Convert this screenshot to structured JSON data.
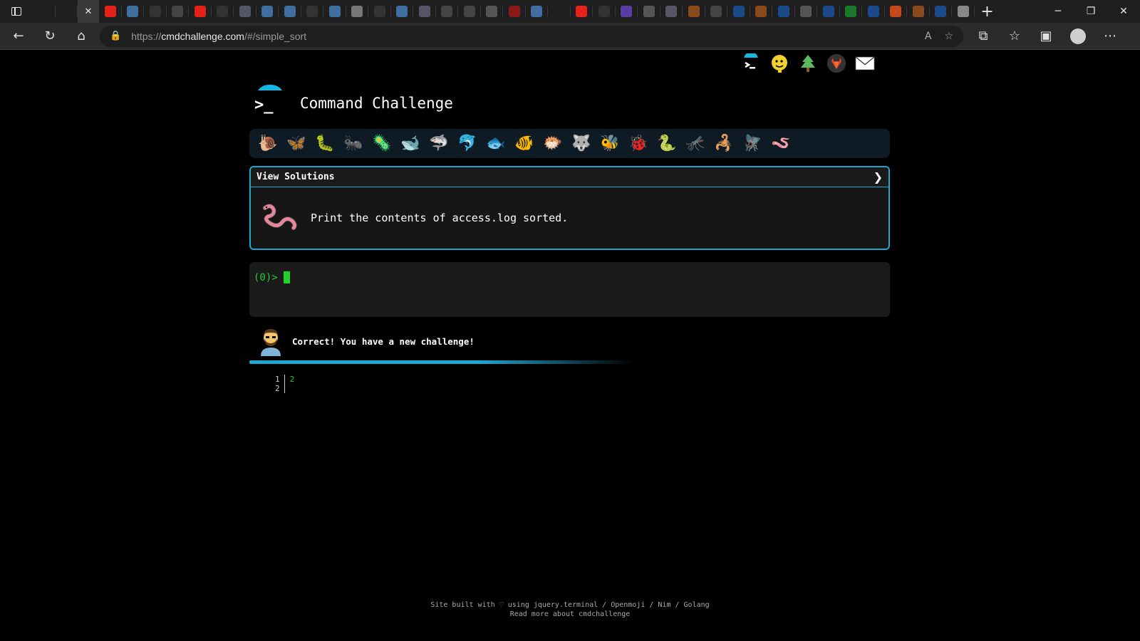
{
  "browser": {
    "url_host": "cmdchallenge.com",
    "url_prefix": "https://",
    "url_path": "/#/simple_sort",
    "tabs": [
      {
        "icon": "blank-icon",
        "color": "#2a2a2a"
      },
      {
        "icon": "blank-icon",
        "color": "#2a2a2a"
      },
      {
        "icon": "close-icon",
        "color": "#3a3a3a",
        "active": true
      },
      {
        "icon": "youtube-icon",
        "color": "#e62117"
      },
      {
        "icon": "python-icon",
        "color": "#3f6fa0"
      },
      {
        "icon": "github-icon",
        "color": "#333"
      },
      {
        "icon": "flickr-icon",
        "color": "#444"
      },
      {
        "icon": "youtube-icon",
        "color": "#e62117"
      },
      {
        "icon": "github-icon",
        "color": "#333"
      },
      {
        "icon": "image-icon",
        "color": "#556"
      },
      {
        "icon": "python-icon",
        "color": "#3f6fa0"
      },
      {
        "icon": "python-icon",
        "color": "#3f6fa0"
      },
      {
        "icon": "github-icon",
        "color": "#333"
      },
      {
        "icon": "python-icon",
        "color": "#3f6fa0"
      },
      {
        "icon": "hexagon-icon",
        "color": "#777"
      },
      {
        "icon": "github-icon",
        "color": "#333"
      },
      {
        "icon": "python-icon",
        "color": "#3f6fa0"
      },
      {
        "icon": "image-icon",
        "color": "#556"
      },
      {
        "icon": "page-icon",
        "color": "#444"
      },
      {
        "icon": "page-icon",
        "color": "#444"
      },
      {
        "icon": "tpg-icon",
        "color": "#555"
      },
      {
        "icon": "youtube-icon",
        "color": "#8a1a1a"
      },
      {
        "icon": "python-icon",
        "color": "#3f6fa0"
      },
      {
        "icon": "blank-icon",
        "color": "#2a2a2a"
      },
      {
        "icon": "youtube-icon",
        "color": "#e62117"
      },
      {
        "icon": "github-icon",
        "color": "#333"
      },
      {
        "icon": "p-icon",
        "color": "#5a3fa0"
      },
      {
        "icon": "table-icon",
        "color": "#555"
      },
      {
        "icon": "image-icon",
        "color": "#556"
      },
      {
        "icon": "stack-icon",
        "color": "#8a4a1a"
      },
      {
        "icon": "page-icon",
        "color": "#444"
      },
      {
        "icon": "search-icon",
        "color": "#1a4a8a"
      },
      {
        "icon": "stack-icon",
        "color": "#8a4a1a"
      },
      {
        "icon": "search-icon",
        "color": "#1a4a8a"
      },
      {
        "icon": "gift-icon",
        "color": "#555"
      },
      {
        "icon": "search-icon",
        "color": "#1a4a8a"
      },
      {
        "icon": "green-icon",
        "color": "#1a7a2a"
      },
      {
        "icon": "search-icon",
        "color": "#1a4a8a"
      },
      {
        "icon": "orange-icon",
        "color": "#c44a1a"
      },
      {
        "icon": "stack-icon",
        "color": "#8a4a1a"
      },
      {
        "icon": "search-icon",
        "color": "#1a4a8a"
      },
      {
        "icon": "gift-icon",
        "color": "#888"
      }
    ]
  },
  "page": {
    "title": "Command Challenge",
    "logo_prompt": ">_",
    "social_icons": [
      "terminal-icon",
      "chat-icon",
      "tree-icon",
      "gitlab-icon",
      "mail-icon"
    ],
    "creatures": [
      "snail-icon",
      "butterfly-icon",
      "caterpillar-icon",
      "ant-icon",
      "microbe-icon",
      "whale-icon",
      "shark-icon",
      "dolphin-icon",
      "fish-icon",
      "tropical-fish-icon",
      "blowfish-icon",
      "wolf-icon",
      "bee-icon",
      "ladybug-icon",
      "worm-green-icon",
      "mosquito-icon",
      "scorpion-icon",
      "fly-icon",
      "worm-pink-icon"
    ],
    "challenge": {
      "header": "View Solutions",
      "chevron": "❯",
      "text": "Print the contents of access.log sorted."
    },
    "terminal": {
      "prompt": "(0)>"
    },
    "success_message": "Correct! You have a new challenge!",
    "output": {
      "line_numbers": [
        "1",
        "2"
      ],
      "lines": [
        "2",
        ""
      ]
    },
    "footer": {
      "line1": "Site built with ♡ using jquery.terminal / Openmoji / Nim / Golang",
      "line2": "Read more about cmdchallenge"
    }
  }
}
